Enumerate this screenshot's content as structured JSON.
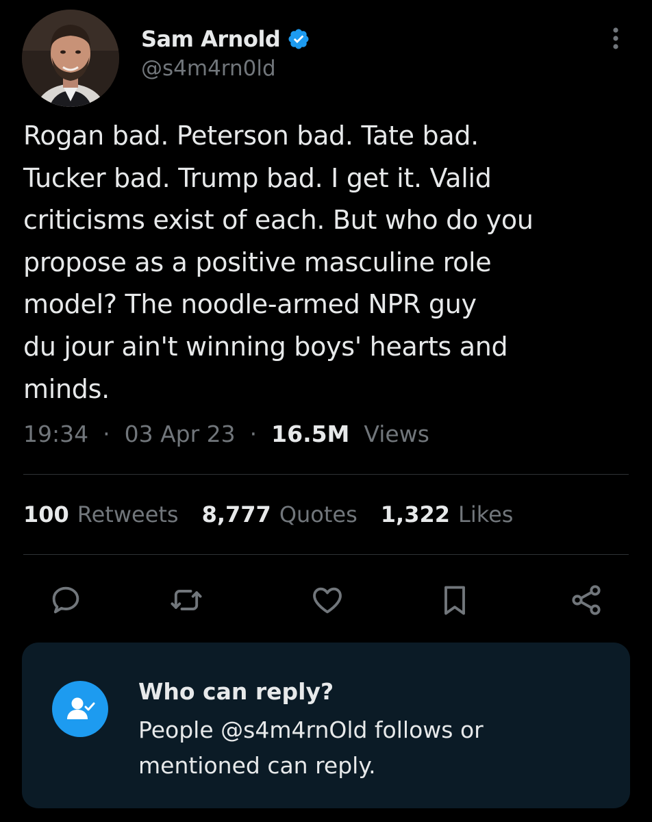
{
  "author": {
    "display_name": "Sam Arnold",
    "handle": "@s4m4rn0ld",
    "verified": true,
    "avatar_icon": "user-avatar-photo",
    "verified_icon": "verified-badge-icon",
    "badge_color": "#1d9bf0"
  },
  "tweet": {
    "text": "Rogan bad. Peterson bad. Tate bad.\nTucker bad. Trump bad. I get it. Valid\ncriticisms exist of each. But who do you\npropose as a positive masculine role\nmodel? The noodle-armed NPR guy\ndu jour ain't winning boys' hearts and\nminds.",
    "time": "19:34",
    "date": "03 Apr 23",
    "separator": "·",
    "views_count": "16.5M",
    "views_label": "Views"
  },
  "stats": [
    {
      "count": "100",
      "label": "Retweets"
    },
    {
      "count": "8,777",
      "label": "Quotes"
    },
    {
      "count": "1,322",
      "label": "Likes"
    }
  ],
  "actions": [
    {
      "name": "reply",
      "icon": "reply-icon"
    },
    {
      "name": "retweet",
      "icon": "retweet-icon"
    },
    {
      "name": "like",
      "icon": "heart-icon"
    },
    {
      "name": "bookmark",
      "icon": "bookmark-icon"
    },
    {
      "name": "share",
      "icon": "share-icon"
    }
  ],
  "reply_restriction": {
    "title": "Who can reply?",
    "description": "People @s4m4rnOld follows or mentioned can reply.",
    "icon": "user-check-icon"
  },
  "colors": {
    "background": "#000000",
    "text_primary": "#e7e9ea",
    "text_secondary": "#71767b",
    "accent": "#1d9bf0",
    "card_background": "#0b1b26",
    "divider": "#2f3336"
  }
}
